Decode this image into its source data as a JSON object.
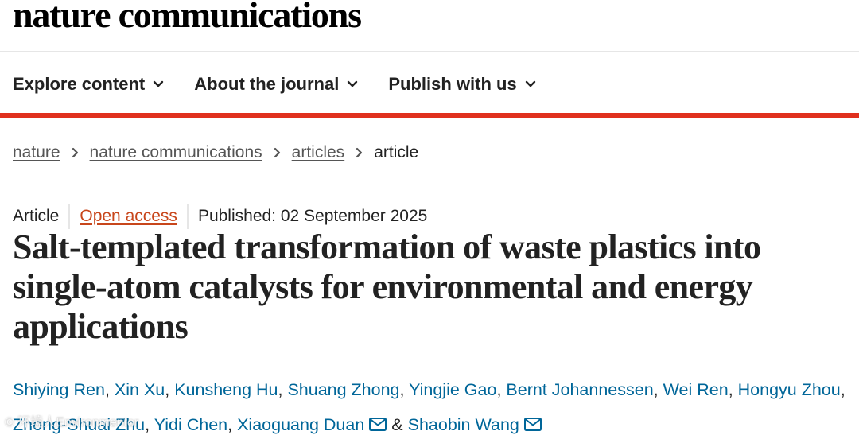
{
  "site": {
    "logo": "nature communications"
  },
  "nav": {
    "items": [
      {
        "label": "Explore content"
      },
      {
        "label": "About the journal"
      },
      {
        "label": "Publish with us"
      }
    ]
  },
  "breadcrumb": [
    "nature",
    "nature communications",
    "articles",
    "article"
  ],
  "article": {
    "type": "Article",
    "access": "Open access",
    "published": "Published: 02 September 2025",
    "title": "Salt-templated transformation of waste plastics into single-atom catalysts for environmental and energy applications",
    "authors": [
      "Shiying Ren",
      "Xin Xu",
      "Kunsheng Hu",
      "Shuang Zhong",
      "Yingjie Gao",
      "Bernt Johannessen",
      "Wei Ren",
      "Hongyu Zhou",
      "Zhong-Shuai Zhu",
      "Yidi Chen",
      "Xiaoguang Duan",
      "Shaobin Wang"
    ],
    "ampersand": "&"
  },
  "colors": {
    "accent_red": "#e0301e",
    "link_blue": "#006699",
    "open_access_orange": "#c8461b"
  },
  "icons": {
    "nav_chevron": "chevron-down-icon",
    "breadcrumb_separator": "chevron-right-icon",
    "author_contact": "mail-icon"
  },
  "watermark": "© 环境人Environmentor"
}
